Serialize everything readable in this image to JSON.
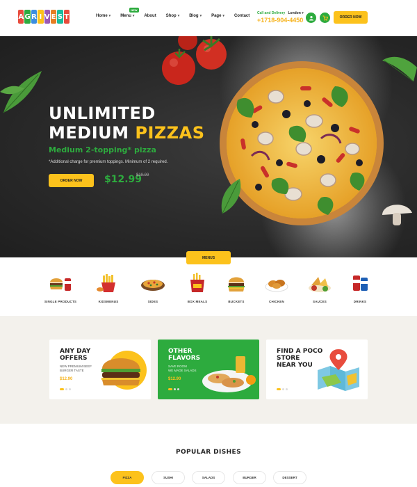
{
  "brand": {
    "logo_text": "AGRIVEST"
  },
  "nav": {
    "items": [
      {
        "label": "Home",
        "has_caret": true
      },
      {
        "label": "Menu",
        "has_caret": true,
        "badge": "NEW"
      },
      {
        "label": "About",
        "has_caret": false
      },
      {
        "label": "Shop",
        "has_caret": true
      },
      {
        "label": "Blog",
        "has_caret": true
      },
      {
        "label": "Page",
        "has_caret": true
      },
      {
        "label": "Contact",
        "has_caret": false
      }
    ]
  },
  "header": {
    "call_label": "Call and Delivery",
    "city": "London",
    "phone": "+1718-904-4450",
    "order_button": "ORDER NOW",
    "icons": [
      "user-icon",
      "cart-icon"
    ]
  },
  "hero": {
    "title_line1": "UNLIMITED",
    "title_line2a": "MEDIUM ",
    "title_line2b": "PIZZAS",
    "subtitle": "Medium 2-topping* pizza",
    "note": "*Additional charge for premium toppings. Minimum of 2 required.",
    "button": "ORDER NOW",
    "price": "$12.99",
    "old_price": "$19.99"
  },
  "menus_tab": "MENUS",
  "categories": [
    {
      "label": "SINGLE PRODUCTS",
      "icon": "burger-drink-icon"
    },
    {
      "label": "KIDSMENUS",
      "icon": "fries-icon"
    },
    {
      "label": "SIDES",
      "icon": "pizza-plate-icon"
    },
    {
      "label": "BOX MEALS",
      "icon": "box-meal-icon"
    },
    {
      "label": "BUCKETS",
      "icon": "burger-icon"
    },
    {
      "label": "CHICKEN",
      "icon": "chicken-icon"
    },
    {
      "label": "SAUCES",
      "icon": "sauce-icon"
    },
    {
      "label": "DRINKS",
      "icon": "drink-can-icon"
    }
  ],
  "offers": [
    {
      "title1": "ANY DAY",
      "title2": "OFFERS",
      "desc1": "NEW PREMIUM BEEF",
      "desc2": "BURGER TASTE",
      "price": "$12.90"
    },
    {
      "title1": "OTHER",
      "title2": "FLAVORS",
      "desc1": "SAVE ROOM",
      "desc2": "WE MADE SALADS",
      "price": "$12.90"
    },
    {
      "title1": "FIND A POCO",
      "title2": "STORE",
      "title3": "NEAR YOU"
    }
  ],
  "popular": {
    "title": "POPULAR DISHES",
    "tabs": [
      "PIZZA",
      "SUSHI",
      "SALADS",
      "BURGER",
      "DESSERT"
    ],
    "active_tab": 0
  },
  "colors": {
    "accent_yellow": "#fcc21c",
    "brand_green": "#2dab3e",
    "hero_dark": "#2a2a2a"
  }
}
